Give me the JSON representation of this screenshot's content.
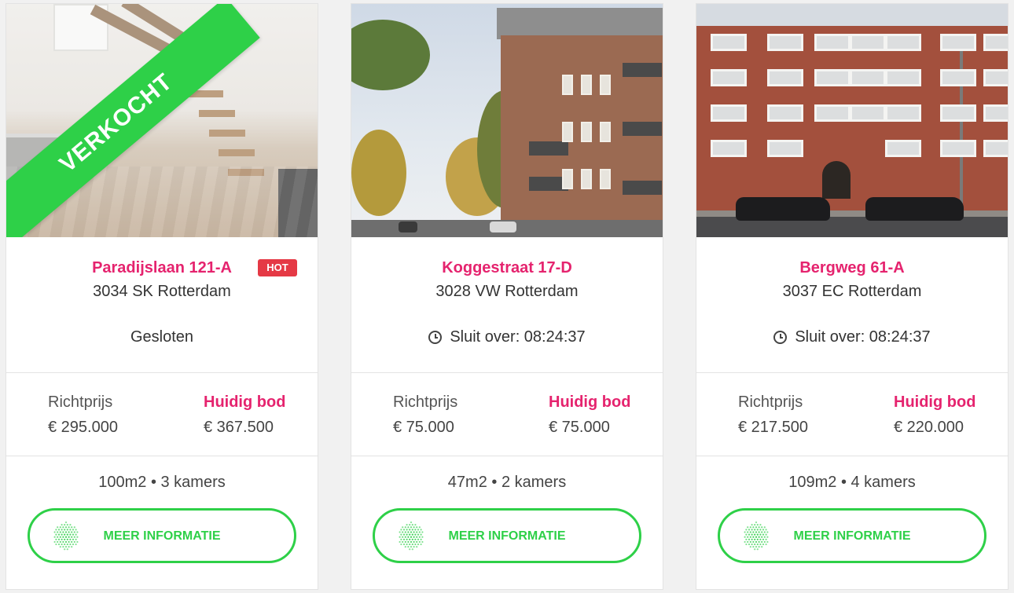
{
  "colors": {
    "accent_pink": "#e5236e",
    "accent_green": "#2ed048",
    "hot_red": "#e53945"
  },
  "cards": [
    {
      "street": "Paradijslaan 121-A",
      "city": "3034 SK Rotterdam",
      "badge": "HOT",
      "ribbon": "VERKOCHT",
      "status": "Gesloten",
      "richtprijs_label": "Richtprijs",
      "richtprijs": "€ 295.000",
      "bod_label": "Huidig bod",
      "bod": "€ 367.500",
      "specs": "100m2 • 3 kamers",
      "button": "MEER INFORMATIE",
      "icon": "hexagon-dots-logo"
    },
    {
      "street": "Koggestraat 17-D",
      "city": "3028 VW Rotterdam",
      "status_icon": "clock-icon",
      "status": "Sluit over: 08:24:37",
      "richtprijs_label": "Richtprijs",
      "richtprijs": "€ 75.000",
      "bod_label": "Huidig bod",
      "bod": "€ 75.000",
      "specs": "47m2 • 2 kamers",
      "button": "MEER INFORMATIE",
      "icon": "hexagon-dots-logo"
    },
    {
      "street": "Bergweg 61-A",
      "city": "3037 EC Rotterdam",
      "status_icon": "clock-icon",
      "status": "Sluit over: 08:24:37",
      "richtprijs_label": "Richtprijs",
      "richtprijs": "€ 217.500",
      "bod_label": "Huidig bod",
      "bod": "€ 220.000",
      "specs": "109m2 • 4 kamers",
      "button": "MEER INFORMATIE",
      "icon": "hexagon-dots-logo"
    }
  ]
}
